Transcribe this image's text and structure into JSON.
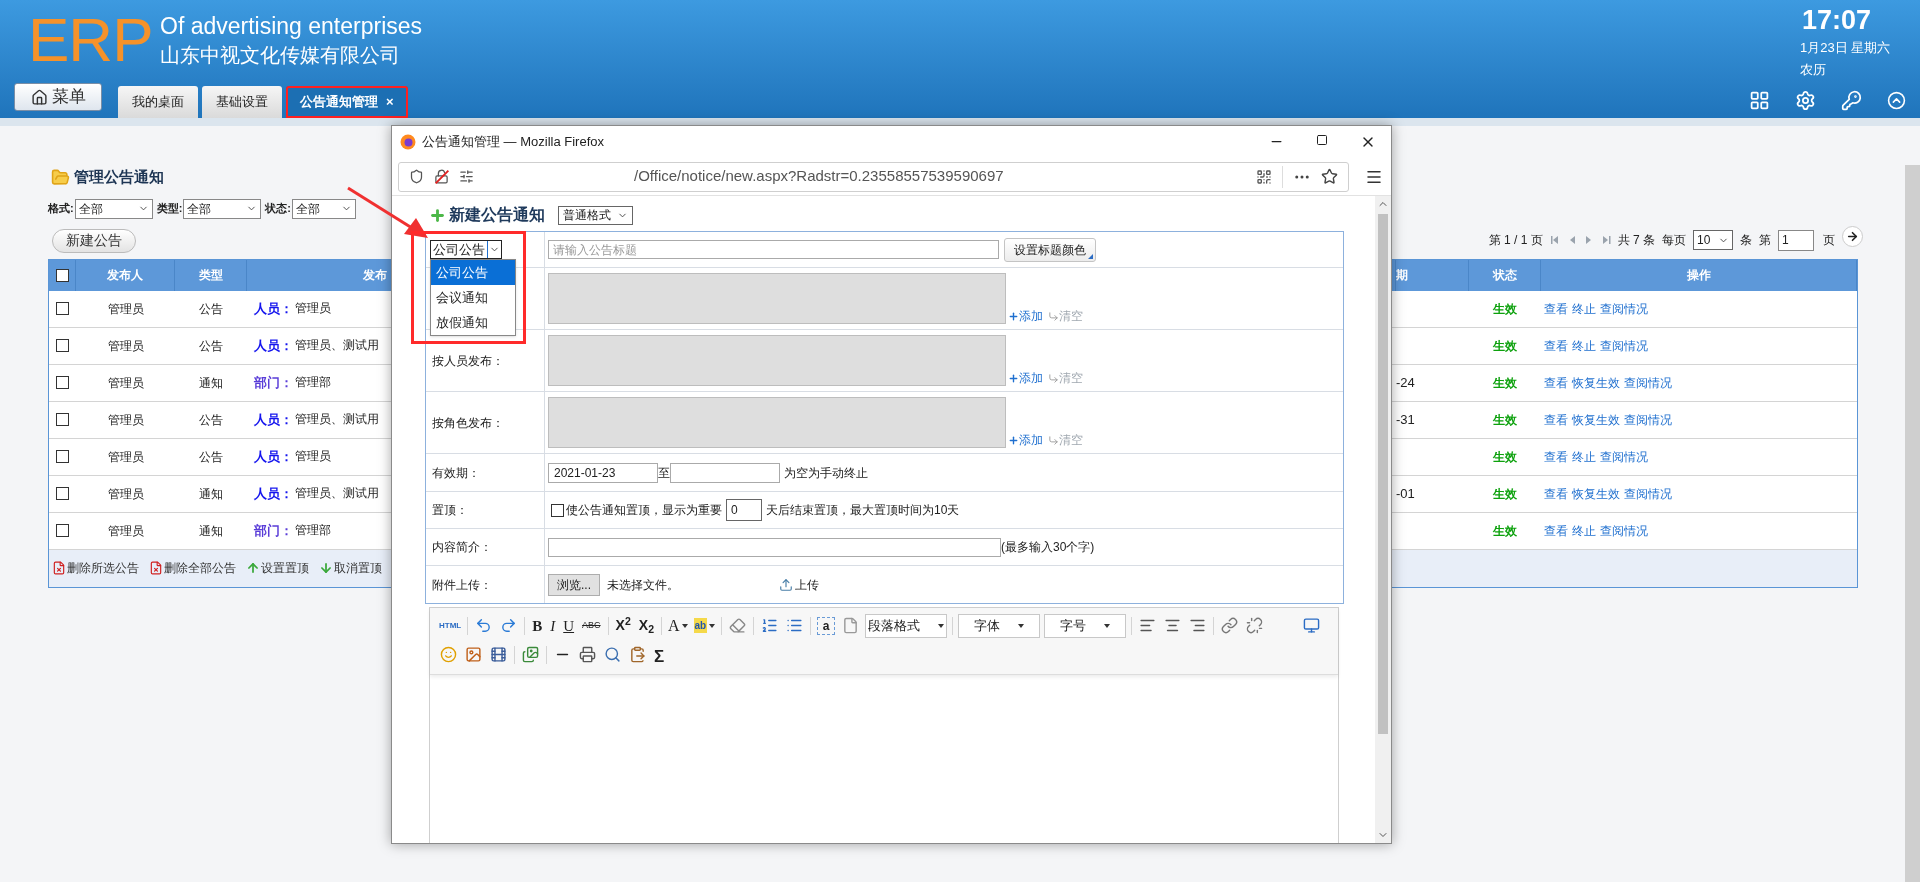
{
  "header": {
    "logo": "ERP",
    "tagline": "Of advertising enterprises",
    "company": "山东中视文化传媒有限公司",
    "menu_button": "菜单",
    "tabs": [
      {
        "label": "我的桌面",
        "selected": false,
        "highlighted": false
      },
      {
        "label": "基础设置",
        "selected": false,
        "highlighted": false
      },
      {
        "label": "公告通知管理",
        "selected": true,
        "highlighted": true,
        "close": "×"
      }
    ],
    "clock": {
      "time": "17:07",
      "date": "1月23日 星期六",
      "lunar": "农历"
    }
  },
  "page": {
    "title": "管理公告通知",
    "filters": [
      {
        "label": "格式:",
        "value": "全部"
      },
      {
        "label": "类型:",
        "value": "全部"
      },
      {
        "label": "状态:",
        "value": "全部"
      }
    ],
    "new_button": "新建公告",
    "pagination": {
      "page_info": "第 1 / 1 页",
      "total": "共 7 条",
      "per_page_label": "每页",
      "per_page": "10",
      "unit": "条",
      "goto_label": "第",
      "goto_page": "1",
      "page_label": "页"
    },
    "table": {
      "header_checked": false,
      "columns": [
        "发布人",
        "类型",
        "发布",
        "期",
        "状态",
        "操作"
      ],
      "rows": [
        {
          "checked": false,
          "publisher": "管理员",
          "type": "公告",
          "color": "#1414ee",
          "scope_label": "人员：",
          "scope": "管理员",
          "status": "生效",
          "actions": [
            "查看",
            "终止",
            "查阅情况"
          ]
        },
        {
          "checked": false,
          "publisher": "管理员",
          "type": "公告",
          "color": "#1414ee",
          "scope_label": "人员：",
          "scope": "管理员、测试用",
          "status": "生效",
          "actions": [
            "查看",
            "终止",
            "查阅情况"
          ]
        },
        {
          "checked": false,
          "publisher": "管理员",
          "type": "通知",
          "color": "#5a3dd8",
          "scope_label": "部门：",
          "scope": "管理部",
          "date_tail": "-24",
          "status": "生效",
          "actions": [
            "查看",
            "恢复生效",
            "查阅情况"
          ]
        },
        {
          "checked": false,
          "publisher": "管理员",
          "type": "公告",
          "color": "#1414ee",
          "scope_label": "人员：",
          "scope": "管理员、测试用",
          "date_tail": "-31",
          "status": "生效",
          "actions": [
            "查看",
            "恢复生效",
            "查阅情况"
          ]
        },
        {
          "checked": false,
          "publisher": "管理员",
          "type": "公告",
          "color": "#1414ee",
          "scope_label": "人员：",
          "scope": "管理员",
          "status": "生效",
          "actions": [
            "查看",
            "终止",
            "查阅情况"
          ]
        },
        {
          "checked": false,
          "publisher": "管理员",
          "type": "通知",
          "color": "#1414ee",
          "scope_label": "人员：",
          "scope": "管理员、测试用",
          "date_tail": "-01",
          "status": "生效",
          "actions": [
            "查看",
            "恢复生效",
            "查阅情况"
          ]
        },
        {
          "checked": false,
          "publisher": "管理员",
          "type": "通知",
          "color": "#5a3dd8",
          "scope_label": "部门：",
          "scope": "管理部",
          "status": "生效",
          "actions": [
            "查看",
            "终止",
            "查阅情况"
          ]
        }
      ]
    },
    "footer_actions": [
      {
        "kind": "delete",
        "label": "删除所选公告"
      },
      {
        "kind": "delete",
        "label": "删除全部公告"
      },
      {
        "kind": "pin",
        "label": "设置置顶"
      },
      {
        "kind": "unpin",
        "label": "取消置顶"
      }
    ]
  },
  "popup": {
    "title": "公告通知管理 — Mozilla Firefox",
    "url": "/Office/notice/new.aspx?Radstr=0.23558557539590697",
    "heading": "新建公告通知",
    "format": "普通格式",
    "type_select": {
      "value": "公司公告",
      "expanded": true,
      "highlighted": true,
      "options": [
        {
          "label": "公司公告",
          "selected": true
        },
        {
          "label": "会议通知",
          "selected": false
        },
        {
          "label": "放假通知",
          "selected": false
        }
      ]
    },
    "title_placeholder": "请输入公告标题",
    "color_button": "设置标题颜色",
    "publish_rows": [
      {
        "add": "添加",
        "clear": "清空"
      },
      {
        "label": "按人员发布：",
        "add": "添加",
        "clear": "清空"
      },
      {
        "label": "按角色发布：",
        "add": "添加",
        "clear": "清空"
      }
    ],
    "validity": {
      "label": "有效期：",
      "start": "2021-01-23",
      "to": "至",
      "hint": "为空为手动终止"
    },
    "pin": {
      "label": "置顶：",
      "checked": false,
      "text_before": "使公告通知置顶，显示为重要",
      "days": "0",
      "text_after": "天后结束置顶，最大置顶时间为10天"
    },
    "summary": {
      "label": "内容简介：",
      "hint": "(最多输入30个字)"
    },
    "attachment": {
      "label": "附件上传：",
      "browse": "浏览...",
      "no_file": "未选择文件。",
      "upload": "上传"
    },
    "toolbar": [
      [
        {
          "kind": "label",
          "label": "HTML"
        },
        {
          "kind": "sep"
        },
        {
          "kind": "undo"
        },
        {
          "kind": "redo"
        },
        {
          "kind": "sep"
        },
        {
          "kind": "bold",
          "label": "B"
        },
        {
          "kind": "italic",
          "label": "I"
        },
        {
          "kind": "underline",
          "label": "U"
        },
        {
          "kind": "strike",
          "label": "ABC"
        },
        {
          "kind": "sep"
        },
        {
          "kind": "sup",
          "label": "X$^{2}$"
        },
        {
          "kind": "sub",
          "label": "X$_{2}$"
        },
        {
          "kind": "sep"
        },
        {
          "kind": "fontcolor",
          "label": "A"
        },
        {
          "kind": "highlight",
          "label": "ab"
        },
        {
          "kind": "sep"
        },
        {
          "kind": "eraser"
        },
        {
          "kind": "sep"
        },
        {
          "kind": "olist"
        },
        {
          "kind": "ulist"
        },
        {
          "kind": "sep"
        },
        {
          "kind": "anchor",
          "label": "a"
        },
        {
          "kind": "page"
        },
        {
          "kind": "select",
          "label": "段落格式"
        },
        {
          "kind": "sep"
        },
        {
          "kind": "select",
          "label": "字体"
        },
        {
          "kind": "select",
          "label": "字号"
        },
        {
          "kind": "sep"
        },
        {
          "kind": "left"
        },
        {
          "kind": "center"
        },
        {
          "kind": "right"
        },
        {
          "kind": "sep"
        },
        {
          "kind": "link"
        },
        {
          "kind": "unlink"
        },
        {
          "kind": "fullscreen"
        }
      ],
      [
        {
          "kind": "emoji"
        },
        {
          "kind": "image"
        },
        {
          "kind": "video"
        },
        {
          "kind": "sep"
        },
        {
          "kind": "gallery"
        },
        {
          "kind": "sep"
        },
        {
          "kind": "rule"
        },
        {
          "kind": "print"
        },
        {
          "kind": "preview"
        },
        {
          "kind": "paste"
        },
        {
          "kind": "sigma",
          "label": "Σ"
        }
      ]
    ]
  }
}
